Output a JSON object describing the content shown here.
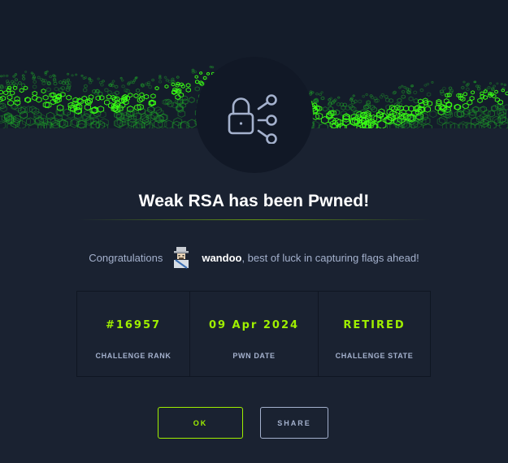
{
  "title": "Weak RSA has been Pwned!",
  "congrats": {
    "prefix": "Congratulations",
    "username": "wandoo",
    "suffix": ", best of luck in capturing flags ahead!"
  },
  "badge_icon": "lock-network-icon",
  "stats": [
    {
      "value": "#16957",
      "label": "CHALLENGE RANK"
    },
    {
      "value": "09 Apr 2024",
      "label": "PWN DATE"
    },
    {
      "value": "RETIRED",
      "label": "CHALLENGE STATE"
    }
  ],
  "buttons": {
    "ok": "OK",
    "share": "SHARE"
  },
  "colors": {
    "accent": "#9fef00",
    "muted": "#a4b1cd",
    "background": "#1a2231"
  }
}
